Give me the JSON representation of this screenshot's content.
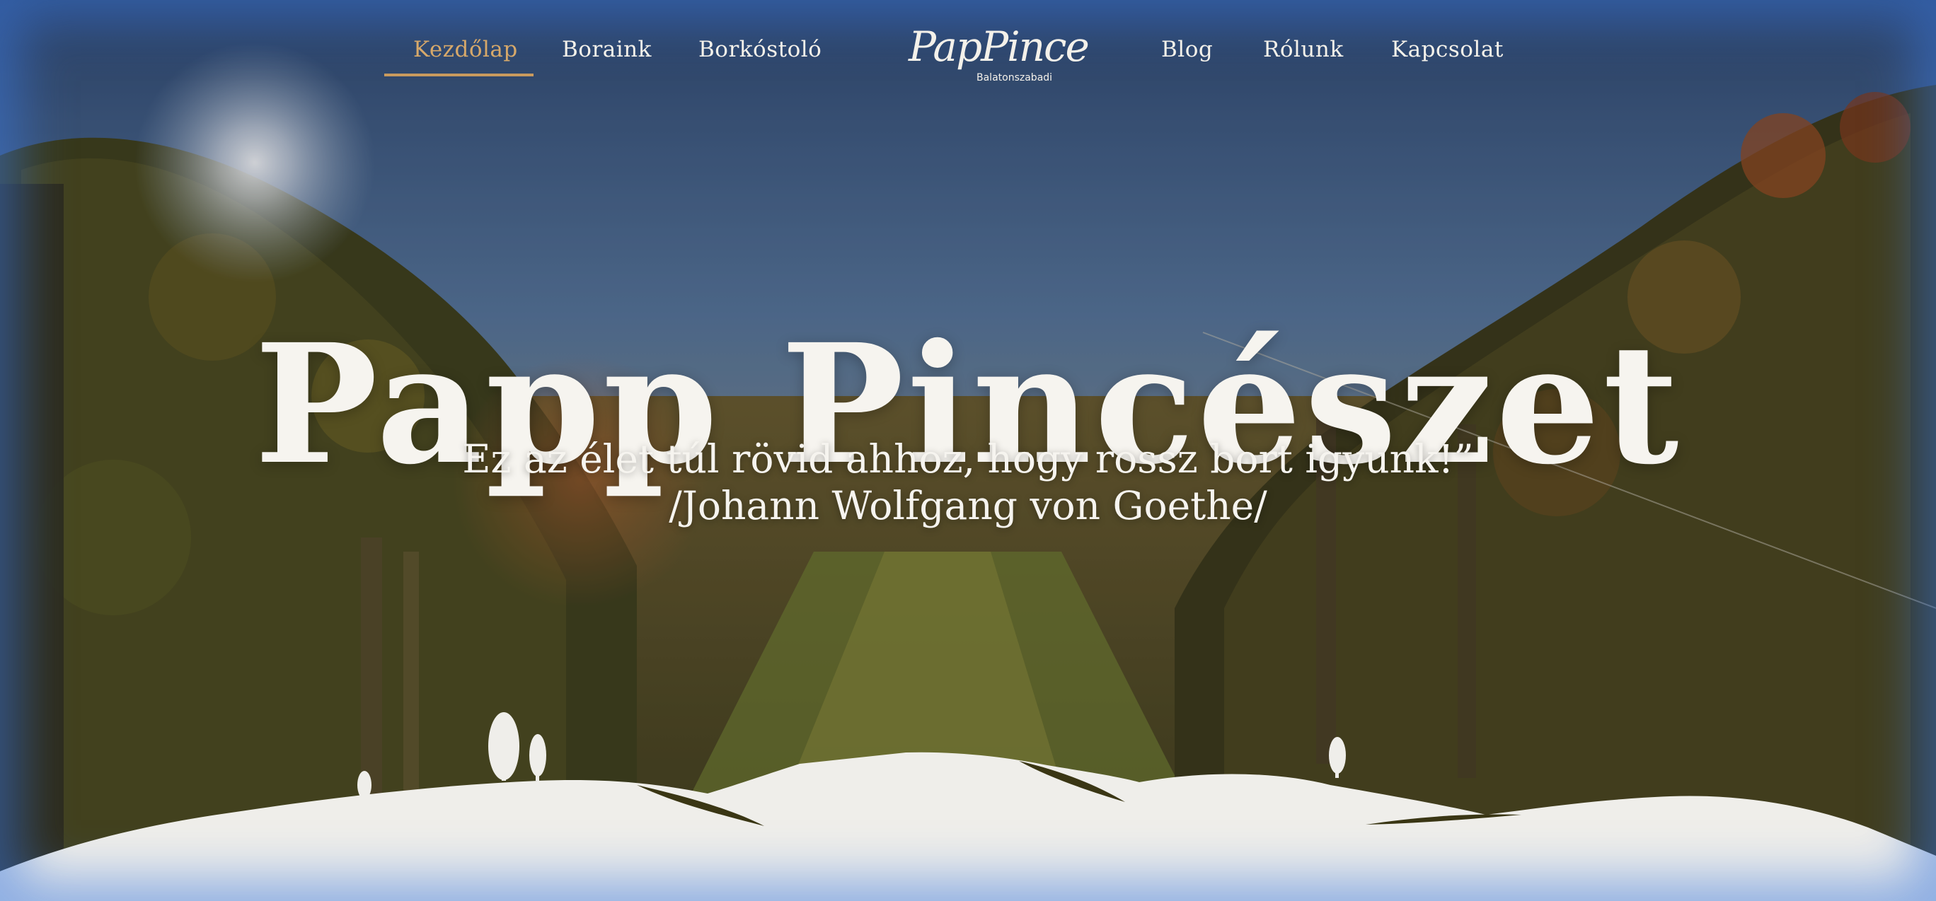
{
  "nav": {
    "left": [
      {
        "label": "Kezdőlap",
        "active": true
      },
      {
        "label": "Boraink",
        "active": false
      },
      {
        "label": "Borkóstoló",
        "active": false
      }
    ],
    "right": [
      {
        "label": "Blog",
        "active": false
      },
      {
        "label": "Rólunk",
        "active": false
      },
      {
        "label": "Kapcsolat",
        "active": false
      }
    ]
  },
  "logo": {
    "title": "PapPince",
    "subtitle": "Balatonszabadi"
  },
  "hero": {
    "title": "Papp Pincészet",
    "quote_line1": "Ez az élet túl rövid ahhoz, hogy rossz bort igyunk!”",
    "quote_line2": "/Johann Wolfgang von Goethe/"
  },
  "colors": {
    "nav_active": "#d6a86a",
    "nav_text": "#f4f1ea",
    "hills": "#efeeea",
    "sky_top": "#2f4a6e",
    "accent_glow": "#3c78dc"
  }
}
